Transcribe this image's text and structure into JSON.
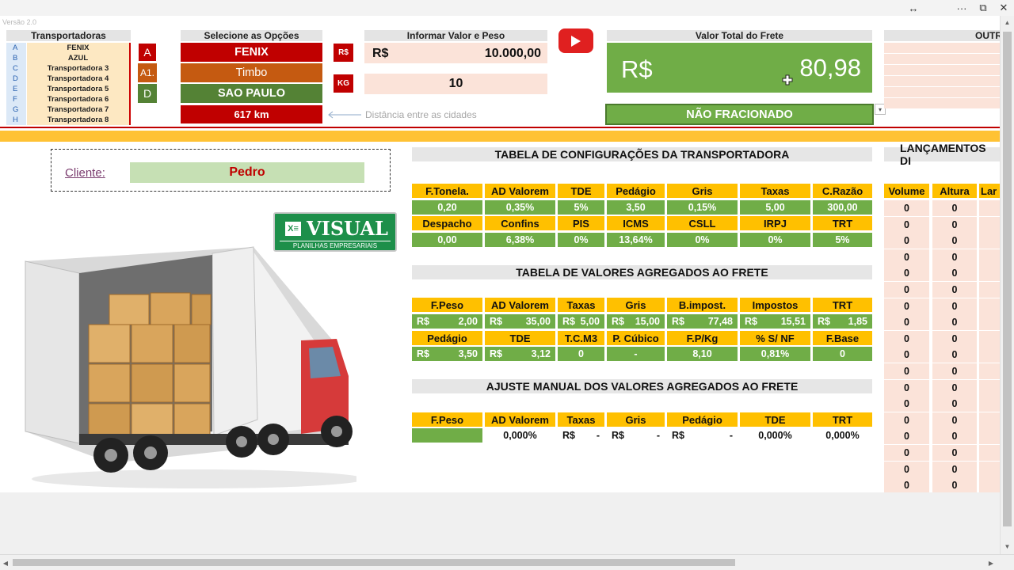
{
  "window": {
    "resize_icon": "↔",
    "more": "···",
    "restore": "⧉",
    "close": "✕"
  },
  "version": "Versão 2.0",
  "transportadoras": {
    "header": "Transportadoras",
    "rows": [
      {
        "letter": "A",
        "name": "FENIX"
      },
      {
        "letter": "B",
        "name": "AZUL"
      },
      {
        "letter": "C",
        "name": "Transportadora 3"
      },
      {
        "letter": "D",
        "name": "Transportadora 4"
      },
      {
        "letter": "E",
        "name": "Transportadora 5"
      },
      {
        "letter": "F",
        "name": "Transportadora 6"
      },
      {
        "letter": "G",
        "name": "Transportadora 7"
      },
      {
        "letter": "H",
        "name": "Transportadora 8"
      }
    ]
  },
  "codes": {
    "c1": "A",
    "c2": "A1.",
    "c3": "D"
  },
  "opcoes": {
    "header": "Selecione as Opções",
    "transportadora": "FENIX",
    "origem": "Timbo",
    "destino": "SAO PAULO",
    "distancia": "617 km",
    "distancia_hint": "Distância entre as cidades"
  },
  "valor_peso": {
    "header": "Informar Valor e Peso",
    "rs_badge": "R$",
    "kg_badge": "KG",
    "currency": "R$",
    "valor": "10.000,00",
    "peso": "10"
  },
  "total": {
    "header": "Valor Total do Frete",
    "currency": "R$",
    "value": "80,98",
    "status": "NÃO FRACIONADO"
  },
  "outros_header": "OUTR",
  "cliente": {
    "label": "Cliente:",
    "name": "Pedro"
  },
  "logo": {
    "brand": "VISUAL",
    "sub": "PLANILHAS EMPRESARIAIS"
  },
  "config": {
    "title": "TABELA DE CONFIGURAÇÕES DA TRANSPORTADORA",
    "h1": [
      "F.Tonela.",
      "AD Valorem",
      "TDE",
      "Pedágio",
      "Gris",
      "Taxas",
      "C.Razão"
    ],
    "v1": [
      "0,20",
      "0,35%",
      "5%",
      "3,50",
      "0,15%",
      "5,00",
      "300,00"
    ],
    "h2": [
      "Despacho",
      "Confins",
      "PIS",
      "ICMS",
      "CSLL",
      "IRPJ",
      "TRT"
    ],
    "v2": [
      "0,00",
      "6,38%",
      "0%",
      "13,64%",
      "0%",
      "0%",
      "5%"
    ]
  },
  "agregados": {
    "title": "TABELA DE VALORES AGREGADOS AO FRETE",
    "h1": [
      "F.Peso",
      "AD Valorem",
      "Taxas",
      "Gris",
      "B.impost.",
      "Impostos",
      "TRT"
    ],
    "v1": [
      "2,00",
      "35,00",
      "5,00",
      "15,00",
      "77,48",
      "15,51",
      "1,85"
    ],
    "h2": [
      "Pedágio",
      "TDE",
      "T.C.M3",
      "P. Cúbico",
      "F.P/Kg",
      "% S/ NF",
      "F.Base"
    ],
    "v2_money": [
      "3,50",
      "3,12"
    ],
    "v2_rest": [
      "0",
      "-",
      "8,10",
      "0,81%",
      "0"
    ],
    "cur": "R$"
  },
  "ajuste": {
    "title": "AJUSTE MANUAL DOS VALORES AGREGADOS AO FRETE",
    "h": [
      "F.Peso",
      "AD Valorem",
      "Taxas",
      "Gris",
      "Pedágio",
      "TDE",
      "TRT"
    ],
    "v": [
      "",
      "0,000%",
      "-",
      "-",
      "-",
      "0,000%",
      "0,000%"
    ],
    "cur": "R$"
  },
  "lancamentos": {
    "title": "LANÇAMENTOS DI",
    "h": [
      "Volume",
      "Altura",
      "Lar"
    ],
    "zero": "0"
  },
  "colors": {
    "red": "#c00000",
    "green": "#70ad47",
    "orange": "#c55a11",
    "yellow": "#ffc000"
  }
}
